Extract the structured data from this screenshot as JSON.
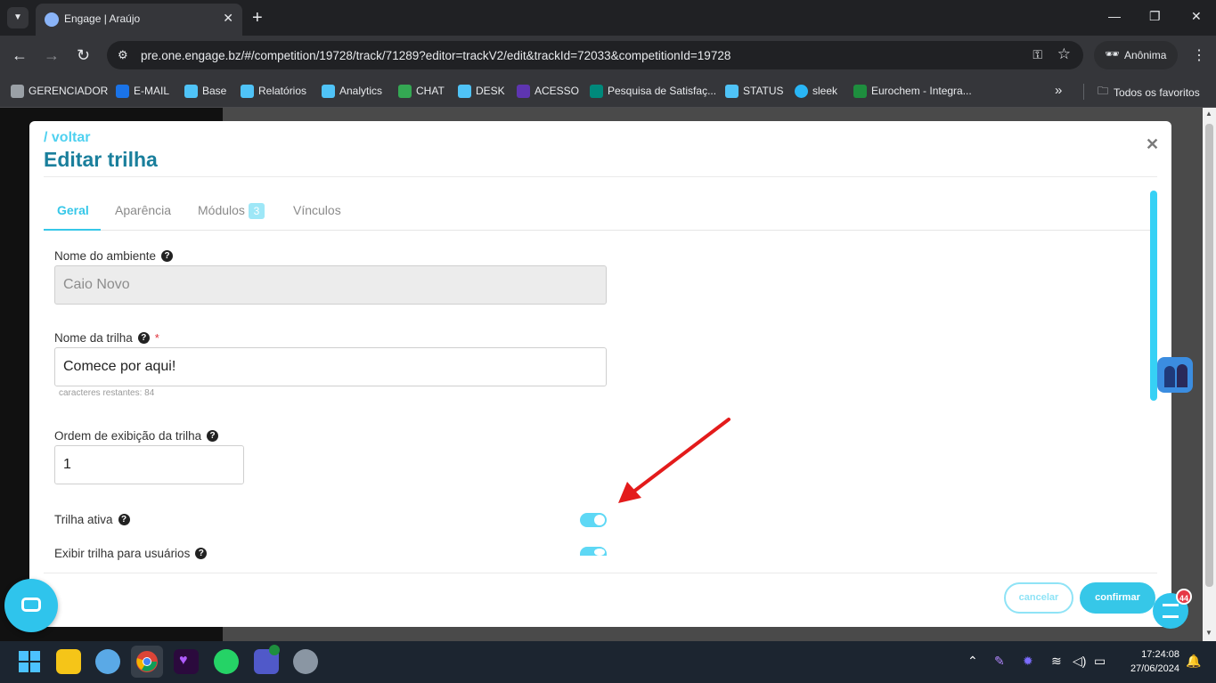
{
  "browser": {
    "tab_title": "Engage | Araújo",
    "url": "pre.one.engage.bz/#/competition/19728/track/71289?editor=trackV2/edit&trackId=72033&competitionId=19728",
    "profile_label": "Anônima",
    "bookmarks": [
      {
        "label": "GERENCIADOR",
        "color": "#9aa0a6"
      },
      {
        "label": "E-MAIL",
        "color": "#1a73e8"
      },
      {
        "label": "Base",
        "color": "#4fc3f7"
      },
      {
        "label": "Relatórios",
        "color": "#4fc3f7"
      },
      {
        "label": "Analytics",
        "color": "#4fc3f7"
      },
      {
        "label": "CHAT",
        "color": "#34a853"
      },
      {
        "label": "DESK",
        "color": "#4fc3f7"
      },
      {
        "label": "ACESSO",
        "color": "#5e35b1"
      },
      {
        "label": "Pesquisa de Satisfaç...",
        "color": "#00897b"
      },
      {
        "label": "STATUS",
        "color": "#4fc3f7"
      },
      {
        "label": "sleek",
        "color": "#29b6f6"
      },
      {
        "label": "Eurochem - Integra...",
        "color": "#1e8e3e"
      }
    ],
    "all_bookmarks_label": "Todos os favoritos"
  },
  "modal": {
    "back_label": "/ voltar",
    "title": "Editar trilha",
    "tabs": [
      {
        "label": "Geral",
        "active": true
      },
      {
        "label": "Aparência"
      },
      {
        "label": "Módulos",
        "badge": "3"
      },
      {
        "label": "Vínculos"
      }
    ],
    "fields": {
      "ambiente_label": "Nome do ambiente",
      "ambiente_value": "Caio Novo",
      "trilha_label": "Nome da trilha",
      "trilha_required": "*",
      "trilha_value": "Comece por aqui!",
      "trilha_hint": "caracteres restantes: 84",
      "ordem_label": "Ordem de exibição da trilha",
      "ordem_value": "1",
      "ativa_label": "Trilha ativa",
      "ativa_on": true,
      "exibir_label": "Exibir trilha para usuários",
      "exibir_on": true
    },
    "buttons": {
      "cancel": "cancelar",
      "confirm": "confirmar"
    }
  },
  "widgets": {
    "notification_count": "44"
  },
  "taskbar": {
    "time": "17:24:08",
    "date": "27/06/2024"
  },
  "colors": {
    "accent": "#36c7e8",
    "title": "#1a7f9c",
    "arrow": "#e31b1b"
  }
}
